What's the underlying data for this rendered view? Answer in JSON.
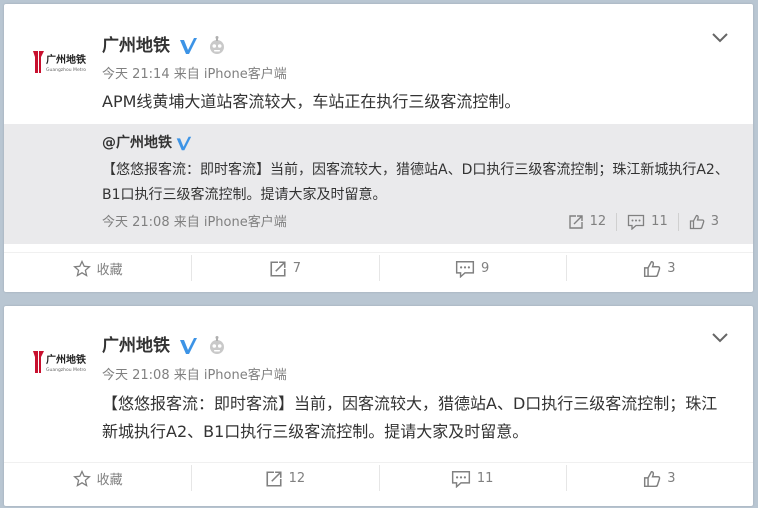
{
  "colors": {
    "background": "#b9c6d2",
    "card": "#ffffff",
    "repost_bg": "#eaeaec",
    "text": "#333333",
    "meta": "#808080",
    "logo_red": "#c8102e",
    "verified_blue": "#3d94e6"
  },
  "posts": [
    {
      "author": "广州地铁",
      "logo_text": "广州地铁",
      "logo_sub": "Guangzhou Metro",
      "meta": "今天 21:14 来自 iPhone客户端",
      "text": "APM线黄埔大道站客流较大，车站正在执行三级客流控制。",
      "repost": {
        "author": "@广州地铁",
        "text": "【悠悠报客流：即时客流】当前，因客流较大，猎德站A、D口执行三级客流控制；珠江新城执行A2、B1口执行三级客流控制。提请大家及时留意。",
        "meta": "今天 21:08 来自 iPhone客户端",
        "reposts": "12",
        "comments": "11",
        "likes": "3"
      },
      "actions": {
        "favorite": "收藏",
        "repost": "7",
        "comment": "9",
        "like": "3"
      }
    },
    {
      "author": "广州地铁",
      "logo_text": "广州地铁",
      "logo_sub": "Guangzhou Metro",
      "meta": "今天 21:08 来自 iPhone客户端",
      "text": "【悠悠报客流：即时客流】当前，因客流较大，猎德站A、D口执行三级客流控制；珠江新城执行A2、B1口执行三级客流控制。提请大家及时留意。",
      "actions": {
        "favorite": "收藏",
        "repost": "12",
        "comment": "11",
        "like": "3"
      }
    }
  ]
}
